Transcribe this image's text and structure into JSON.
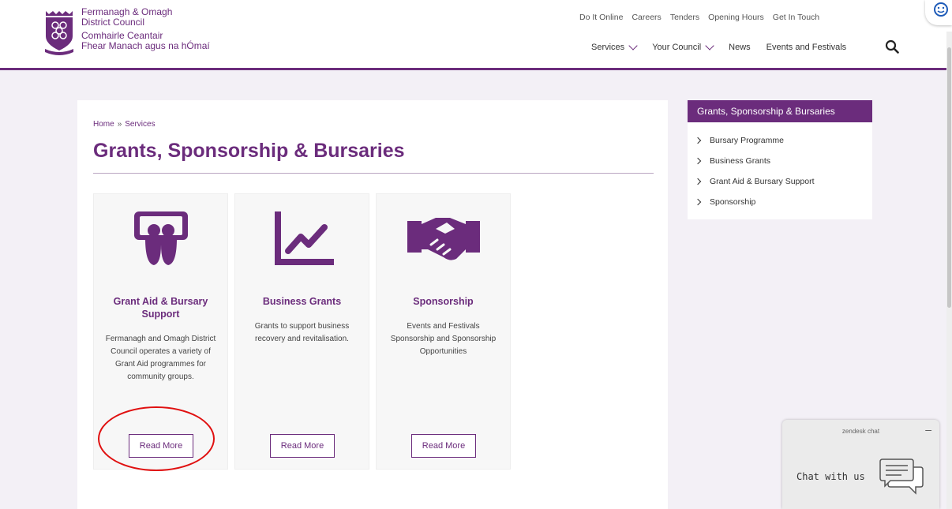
{
  "header": {
    "org_name_line1": "Fermanagh & Omagh",
    "org_name_line2": "District Council",
    "org_irish_line1": "Comhairle Ceantair",
    "org_irish_line2": "Fhear Manach agus na hÓmaí",
    "top_links": [
      "Do It Online",
      "Careers",
      "Tenders",
      "Opening Hours",
      "Get In Touch"
    ],
    "nav": {
      "services": "Services",
      "your_council": "Your Council",
      "news": "News",
      "events": "Events and Festivals"
    }
  },
  "breadcrumb": {
    "home": "Home",
    "separator": "»",
    "current": "Services"
  },
  "page_title": "Grants, Sponsorship & Bursaries",
  "cards": [
    {
      "icon": "presenter-icon",
      "title": "Grant Aid & Bursary Support",
      "description": "Fermanagh and Omagh District Council operates a variety of Grant Aid programmes for community groups.",
      "button": "Read More"
    },
    {
      "icon": "line-chart-icon",
      "title": "Business Grants",
      "description": "Grants to support business recovery and revitalisation.",
      "button": "Read More"
    },
    {
      "icon": "handshake-icon",
      "title": "Sponsorship",
      "description": "Events and Festivals Sponsorship and Sponsorship Opportunities",
      "button": "Read More"
    }
  ],
  "sidebar": {
    "title": "Grants, Sponsorship & Bursaries",
    "items": [
      "Bursary Programme",
      "Business Grants",
      "Grant Aid & Bursary Support",
      "Sponsorship"
    ]
  },
  "chat": {
    "brand": "zendesk chat",
    "minimize": "–",
    "label": "Chat with us"
  },
  "colors": {
    "brand_purple": "#6b2c7c",
    "annotation_red": "#e01010",
    "page_background": "#f3f0f6"
  }
}
